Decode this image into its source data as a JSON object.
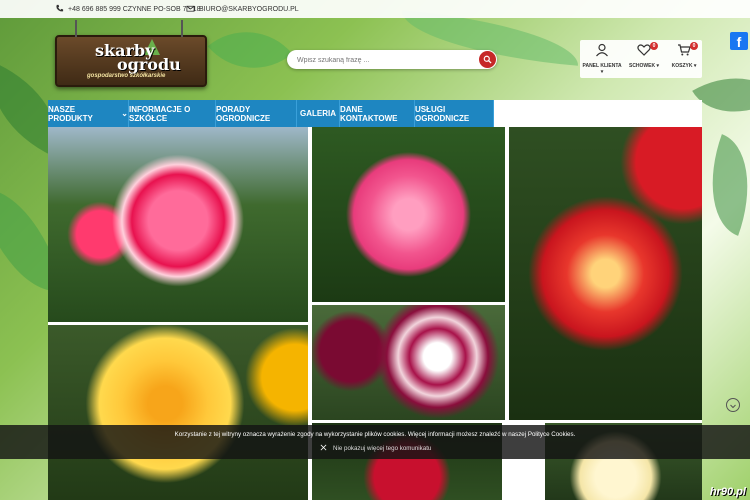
{
  "topbar": {
    "phone": "+48 696 885 999 CZYNNE PO-SOB 7 - 18",
    "email": "BIURO@SKARBYOGRODU.PL"
  },
  "logo": {
    "line1": "skarby",
    "line2": "ogrodu",
    "tagline": "gospodarstwo szkółkarskie"
  },
  "search": {
    "placeholder": "Wpisz szukaną frazę ..."
  },
  "account": {
    "panel_label": "PANEL KLIENTA",
    "wishlist_label": "SCHOWEK",
    "wishlist_count": "0",
    "cart_label": "KOSZYK",
    "cart_count": "0"
  },
  "nav": {
    "tabs": [
      {
        "label": "NASZE PRODUKTY"
      },
      {
        "label": "INFORMACJE O SZKÓŁCE"
      },
      {
        "label": "PORADY OGRODNICZE"
      },
      {
        "label": "GALERIA"
      },
      {
        "label": "DANE KONTAKTOWE"
      },
      {
        "label": "USŁUGI OGRODNICZE"
      }
    ]
  },
  "social": {
    "facebook_letter": "f"
  },
  "cookie": {
    "message": "Korzystanie z tej witryny oznacza wyrażenie zgody na wykorzystanie plików cookies. Więcej informacji możesz znaleźć w naszej Polityce Cookies.",
    "dismiss": "Nie pokazuj więcej tego komunikatu"
  },
  "watermark": "hr90.pl",
  "colors": {
    "nav_blue": "#1e86c1",
    "search_button": "#c62828",
    "badge": "#d32f2f"
  }
}
